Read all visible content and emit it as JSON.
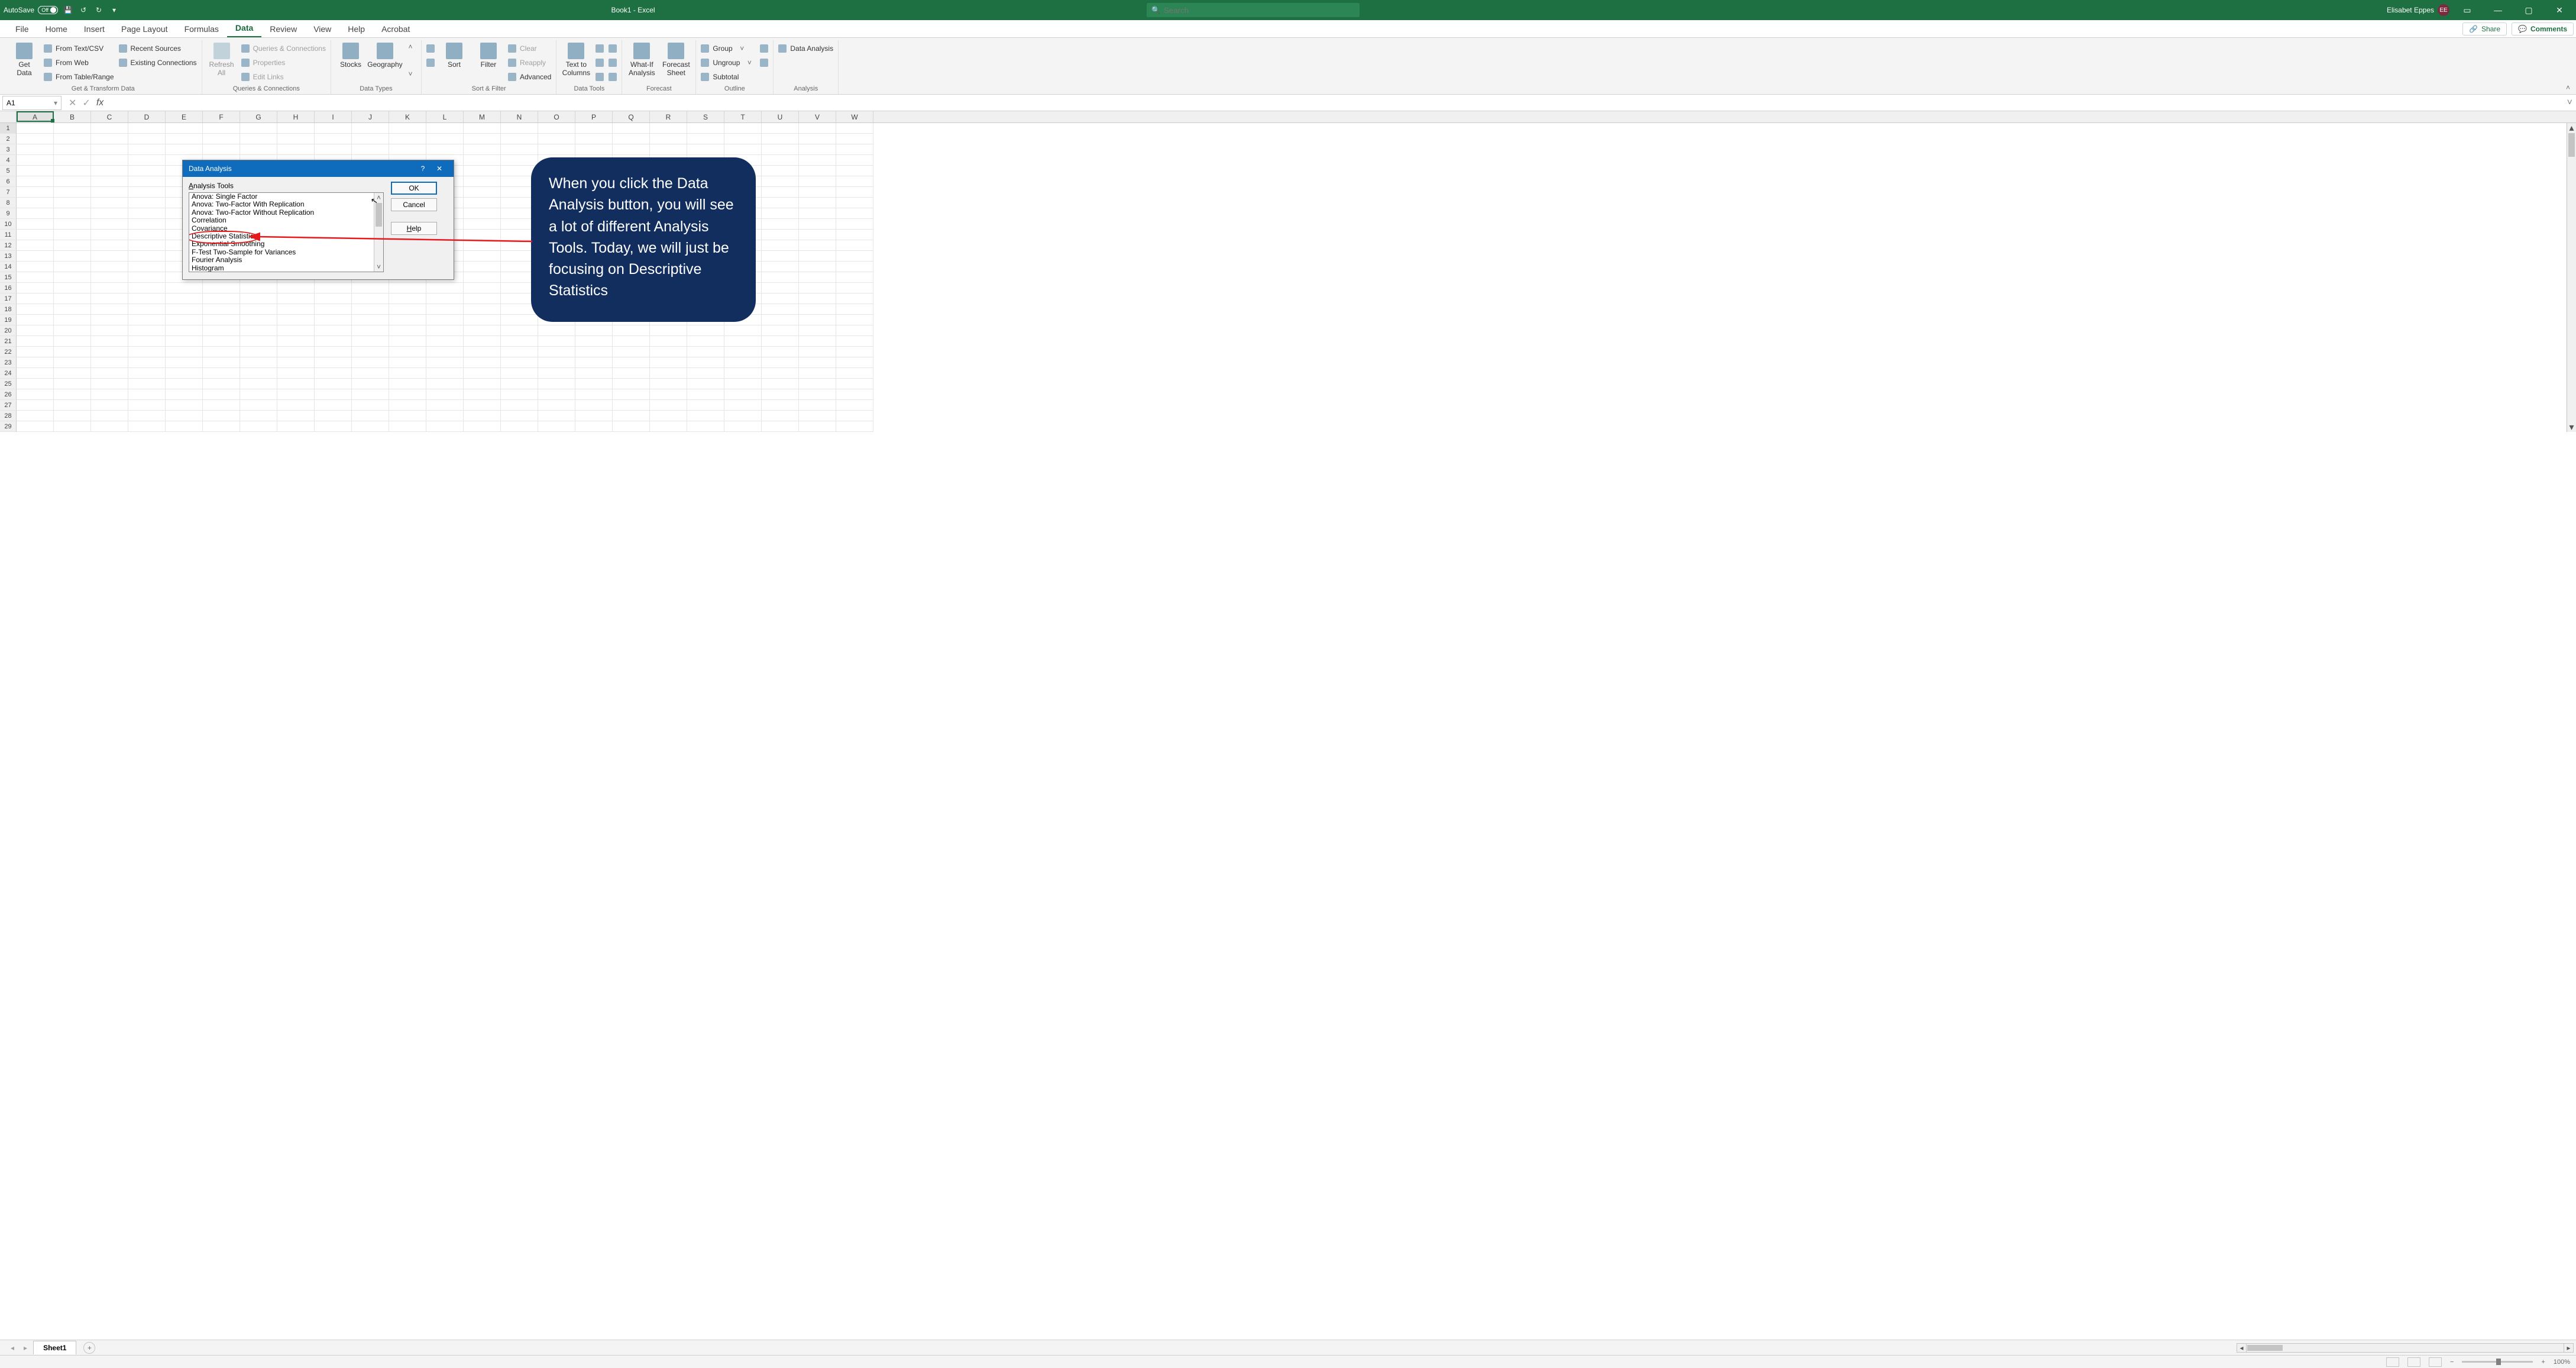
{
  "titlebar": {
    "autosave_label": "AutoSave",
    "autosave_state": "Off",
    "book": "Book1 - Excel",
    "search_placeholder": "Search",
    "user_name": "Elisabet Eppes",
    "user_initials": "EE"
  },
  "tabs": {
    "items": [
      "File",
      "Home",
      "Insert",
      "Page Layout",
      "Formulas",
      "Data",
      "Review",
      "View",
      "Help",
      "Acrobat"
    ],
    "active": "Data",
    "share": "Share",
    "comments": "Comments"
  },
  "ribbon": {
    "get_data": "Get\nData",
    "g1": {
      "a": "From Text/CSV",
      "b": "From Web",
      "c": "From Table/Range",
      "d": "Recent Sources",
      "e": "Existing Connections",
      "label": "Get & Transform Data"
    },
    "g2": {
      "refresh": "Refresh\nAll",
      "a": "Queries & Connections",
      "b": "Properties",
      "c": "Edit Links",
      "label": "Queries & Connections"
    },
    "g3": {
      "stocks": "Stocks",
      "geo": "Geography",
      "label": "Data Types"
    },
    "g4": {
      "sort": "Sort",
      "filter": "Filter",
      "clear": "Clear",
      "reapply": "Reapply",
      "advanced": "Advanced",
      "label": "Sort & Filter"
    },
    "g5": {
      "ttc": "Text to\nColumns",
      "label": "Data Tools"
    },
    "g6": {
      "whatif": "What-If\nAnalysis",
      "forecast": "Forecast\nSheet",
      "label": "Forecast"
    },
    "g7": {
      "group": "Group",
      "ungroup": "Ungroup",
      "subtotal": "Subtotal",
      "label": "Outline"
    },
    "g8": {
      "da": "Data Analysis",
      "label": "Analysis"
    }
  },
  "name_box": "A1",
  "columns": [
    "A",
    "B",
    "C",
    "D",
    "E",
    "F",
    "G",
    "H",
    "I",
    "J",
    "K",
    "L",
    "M",
    "N",
    "O",
    "P",
    "Q",
    "R",
    "S",
    "T",
    "U",
    "V",
    "W"
  ],
  "rows": [
    "1",
    "2",
    "3",
    "4",
    "5",
    "6",
    "7",
    "8",
    "9",
    "10",
    "11",
    "12",
    "13",
    "14",
    "15",
    "16",
    "17",
    "18",
    "19",
    "20",
    "21",
    "22",
    "23",
    "24",
    "25",
    "26",
    "27",
    "28",
    "29"
  ],
  "dialog": {
    "title": "Data Analysis",
    "list_label_pre": "A",
    "list_label_post": "nalysis Tools",
    "items": [
      "Anova: Single Factor",
      "Anova: Two-Factor With Replication",
      "Anova: Two-Factor Without Replication",
      "Correlation",
      "Covariance",
      "Descriptive Statistics",
      "Exponential Smoothing",
      "F-Test Two-Sample for Variances",
      "Fourier Analysis",
      "Histogram"
    ],
    "highlight_index": 5,
    "ok": "OK",
    "cancel": "Cancel",
    "help": "Help",
    "help_ul": "H"
  },
  "callout_text": "When you click the Data Analysis button, you will see a lot of different Analysis Tools. Today, we will just be focusing on Descriptive Statistics",
  "sheet": {
    "name": "Sheet1"
  },
  "status": {
    "zoom": "100%"
  }
}
